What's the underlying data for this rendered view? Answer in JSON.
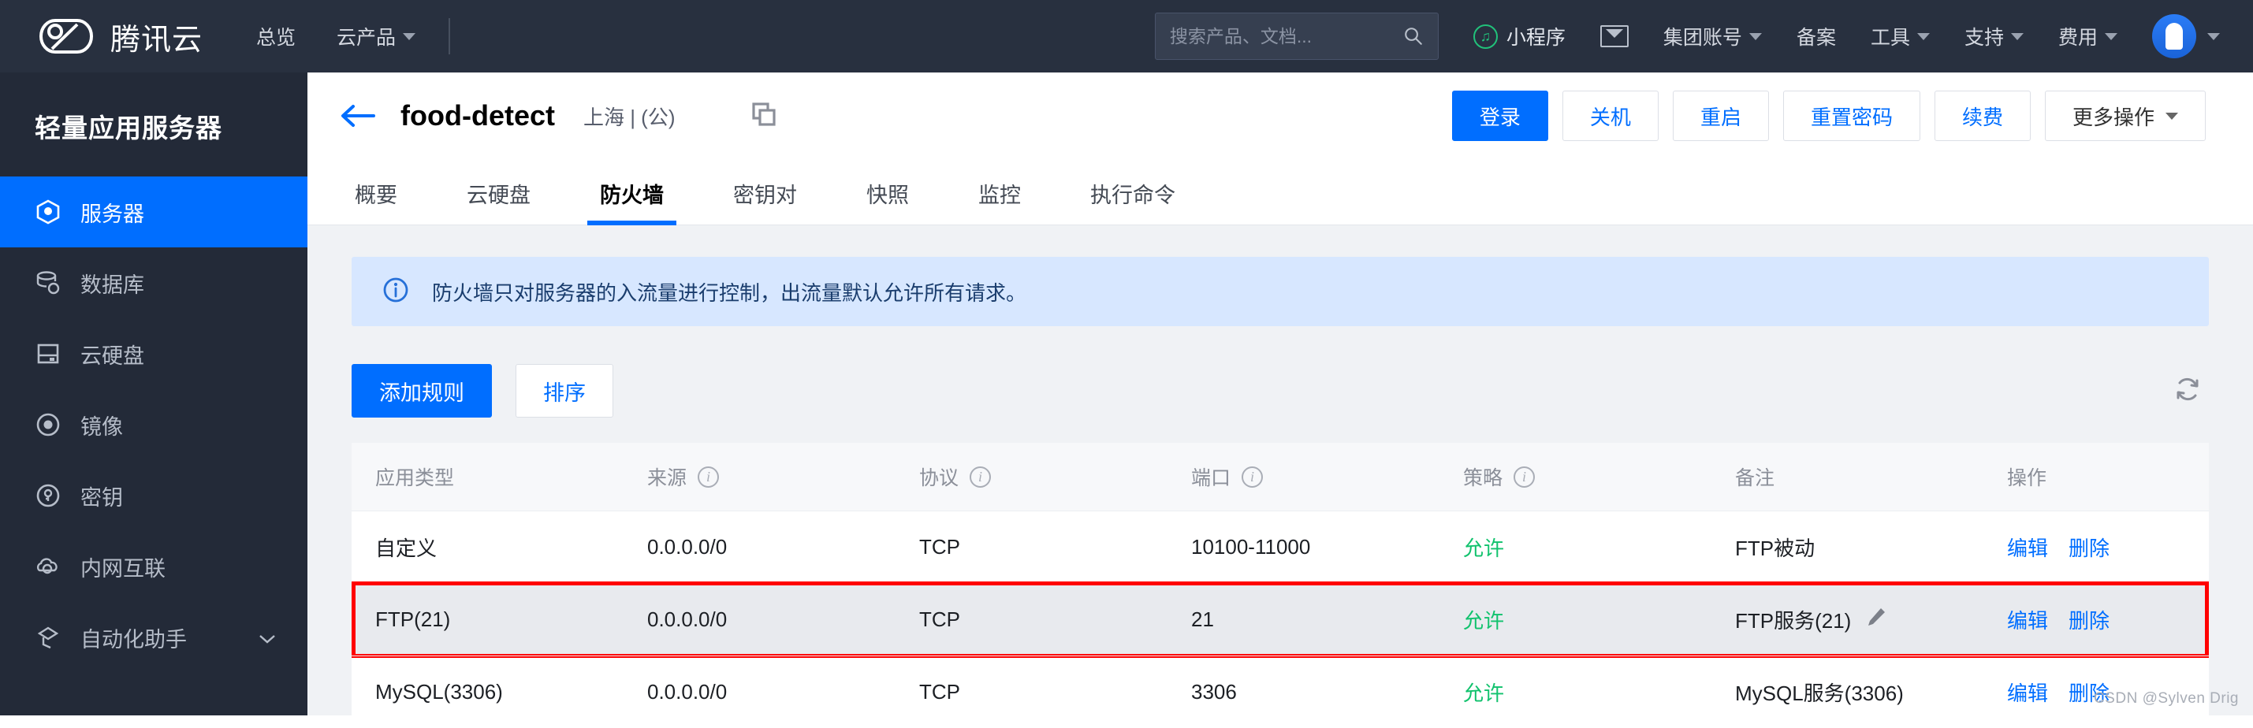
{
  "header": {
    "brand": "腾讯云",
    "nav": [
      {
        "label": "总览",
        "has_caret": false
      },
      {
        "label": "云产品",
        "has_caret": true
      }
    ],
    "search": {
      "placeholder": "搜索产品、文档...",
      "value": "",
      "icon": "search-icon"
    },
    "mini_program": "小程序",
    "mail_icon": "mail-icon",
    "right_nav": [
      {
        "label": "集团账号",
        "has_caret": true
      },
      {
        "label": "备案",
        "has_caret": false
      },
      {
        "label": "工具",
        "has_caret": true
      },
      {
        "label": "支持",
        "has_caret": true
      },
      {
        "label": "费用",
        "has_caret": true
      }
    ],
    "avatar": {
      "icon": "avatar",
      "has_caret": true
    }
  },
  "sidebar": {
    "title": "轻量应用服务器",
    "items": [
      {
        "label": "服务器",
        "icon": "server-icon",
        "active": true,
        "chevron": false
      },
      {
        "label": "数据库",
        "icon": "database-icon",
        "active": false,
        "chevron": false
      },
      {
        "label": "云硬盘",
        "icon": "disk-icon",
        "active": false,
        "chevron": false
      },
      {
        "label": "镜像",
        "icon": "image-icon",
        "active": false,
        "chevron": false
      },
      {
        "label": "密钥",
        "icon": "key-icon",
        "active": false,
        "chevron": false
      },
      {
        "label": "内网互联",
        "icon": "network-icon",
        "active": false,
        "chevron": false
      },
      {
        "label": "自动化助手",
        "icon": "automation-icon",
        "active": false,
        "chevron": true
      }
    ]
  },
  "page": {
    "back_icon": "back-arrow-icon",
    "title": "food-detect",
    "region": "上海 | (公)",
    "copy_icon": "copy-icon",
    "actions": [
      {
        "label": "登录",
        "style": "primary"
      },
      {
        "label": "关机",
        "style": "outline"
      },
      {
        "label": "重启",
        "style": "outline"
      },
      {
        "label": "重置密码",
        "style": "outline"
      },
      {
        "label": "续费",
        "style": "outline"
      },
      {
        "label": "更多操作",
        "style": "gray",
        "has_caret": true
      }
    ],
    "tabs": [
      {
        "label": "概要",
        "active": false
      },
      {
        "label": "云硬盘",
        "active": false
      },
      {
        "label": "防火墙",
        "active": true
      },
      {
        "label": "密钥对",
        "active": false
      },
      {
        "label": "快照",
        "active": false
      },
      {
        "label": "监控",
        "active": false
      },
      {
        "label": "执行命令",
        "active": false
      }
    ]
  },
  "alert": {
    "icon": "info-circle-icon",
    "text": "防火墙只对服务器的入流量进行控制，出流量默认允许所有请求。"
  },
  "toolbar": {
    "add_rule_label": "添加规则",
    "sort_label": "排序",
    "refresh_icon": "refresh-icon"
  },
  "table": {
    "columns": [
      {
        "key": "app_type",
        "label": "应用类型",
        "info": false
      },
      {
        "key": "source",
        "label": "来源",
        "info": true
      },
      {
        "key": "protocol",
        "label": "协议",
        "info": true
      },
      {
        "key": "port",
        "label": "端口",
        "info": true
      },
      {
        "key": "policy",
        "label": "策略",
        "info": true
      },
      {
        "key": "note",
        "label": "备注",
        "info": false
      },
      {
        "key": "ops",
        "label": "操作",
        "info": false
      }
    ],
    "rows": [
      {
        "app_type": "自定义",
        "source": "0.0.0.0/0",
        "protocol": "TCP",
        "port": "10100-11000",
        "policy": "允许",
        "note": "FTP被动",
        "note_editable": false,
        "edit_label": "编辑",
        "delete_label": "删除",
        "highlighted": false
      },
      {
        "app_type": "FTP(21)",
        "source": "0.0.0.0/0",
        "protocol": "TCP",
        "port": "21",
        "policy": "允许",
        "note": "FTP服务(21)",
        "note_editable": true,
        "edit_label": "编辑",
        "delete_label": "删除",
        "highlighted": true
      },
      {
        "app_type": "MySQL(3306)",
        "source": "0.0.0.0/0",
        "protocol": "TCP",
        "port": "3306",
        "policy": "允许",
        "note": "MySQL服务(3306)",
        "note_editable": false,
        "edit_label": "编辑",
        "delete_label": "删除",
        "highlighted": false
      }
    ]
  },
  "colors": {
    "accent": "#006eff",
    "allow": "#11c26d",
    "highlight_border": "#ff0000",
    "header_bg": "#28303f",
    "sidebar_bg": "#232a38"
  },
  "watermark": "CSDN @Sylven Drig"
}
